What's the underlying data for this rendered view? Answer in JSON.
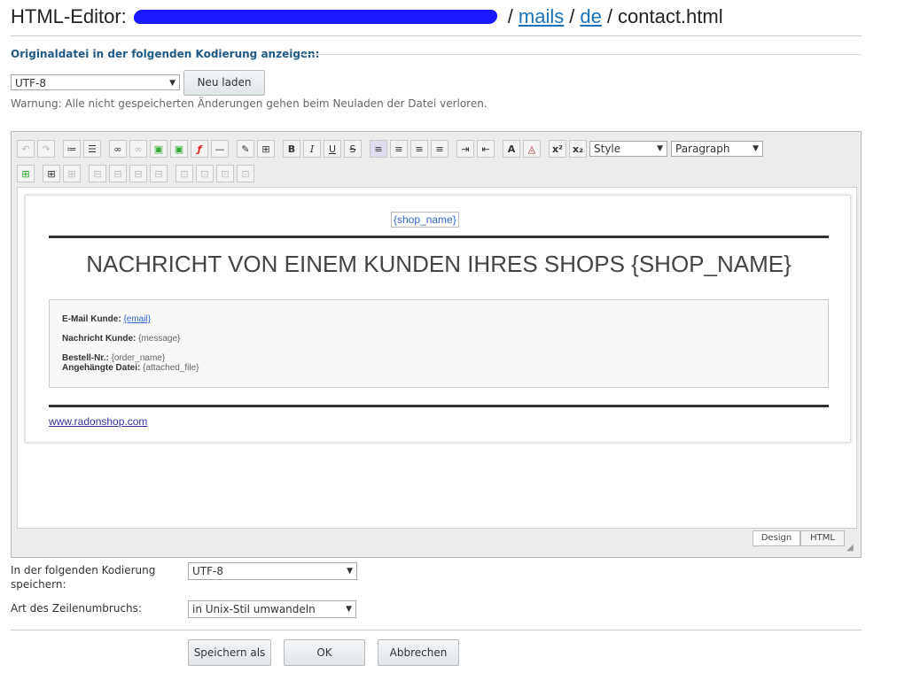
{
  "header": {
    "title_prefix": "HTML-Editor:",
    "crumb_mails": "mails",
    "crumb_de": "de",
    "filename": "contact.html",
    "slash": "/"
  },
  "load_section": {
    "legend": "Originaldatei in der folgenden Kodierung anzeigen:",
    "encoding_value": "UTF-8",
    "reload_label": "Neu laden",
    "warning": "Warnung: Alle nicht gespeicherten Änderungen gehen beim Neuladen der Datei verloren."
  },
  "toolbar": {
    "style_select": "Style",
    "paragraph_select": "Paragraph",
    "bold": "B",
    "italic": "I",
    "underline": "U",
    "strike": "S",
    "superscript": "x²",
    "subscript": "x₂",
    "font_color": "A"
  },
  "mail": {
    "logo_alt": "{shop_name}",
    "heading": "NACHRICHT VON EINEM KUNDEN IHRES SHOPS {SHOP_NAME}",
    "email_label": "E-Mail Kunde:",
    "email_value": "{email}",
    "message_label": "Nachricht Kunde:",
    "message_value": "{message}",
    "order_label": "Bestell-Nr.:",
    "order_value": "{order_name}",
    "attached_label": "Angehängte Datei:",
    "attached_value": "{attached_file}",
    "footer_link": "www.radonshop.com"
  },
  "editor_tabs": {
    "design": "Design",
    "html": "HTML"
  },
  "save_section": {
    "encoding_label": "In der folgenden Kodierung speichern:",
    "encoding_value": "UTF-8",
    "linebreak_label": "Art des Zeilenumbruchs:",
    "linebreak_value": "in Unix-Stil umwandeln"
  },
  "actions": {
    "save_as": "Speichern als",
    "ok": "OK",
    "cancel": "Abbrechen"
  },
  "colors": {
    "link": "#1a73b8",
    "legend": "#1f5a85",
    "redaction": "#1a1aff"
  }
}
